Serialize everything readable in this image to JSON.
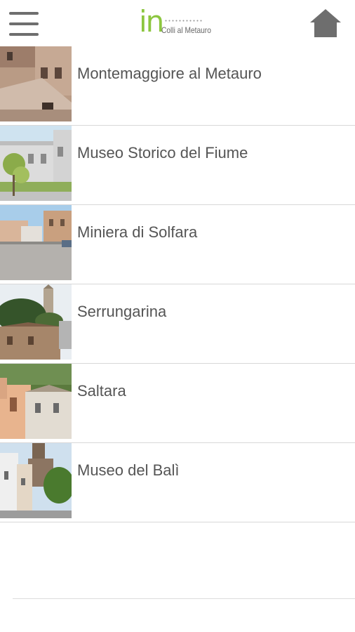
{
  "header": {
    "logo_main": "in",
    "logo_sub": "Colli al Metauro",
    "menu_icon": "hamburger-menu-icon",
    "home_icon": "home-icon"
  },
  "colors": {
    "brand_green": "#8cc63f",
    "text_gray": "#555555",
    "icon_gray": "#6e6e6e",
    "divider": "#d8d8d8"
  },
  "places": [
    {
      "name": "Montemaggiore al Metauro"
    },
    {
      "name": "Museo Storico del Fiume"
    },
    {
      "name": "Miniera di Solfara"
    },
    {
      "name": "Serrungarina"
    },
    {
      "name": "Saltara"
    },
    {
      "name": "Museo del Balì"
    }
  ]
}
